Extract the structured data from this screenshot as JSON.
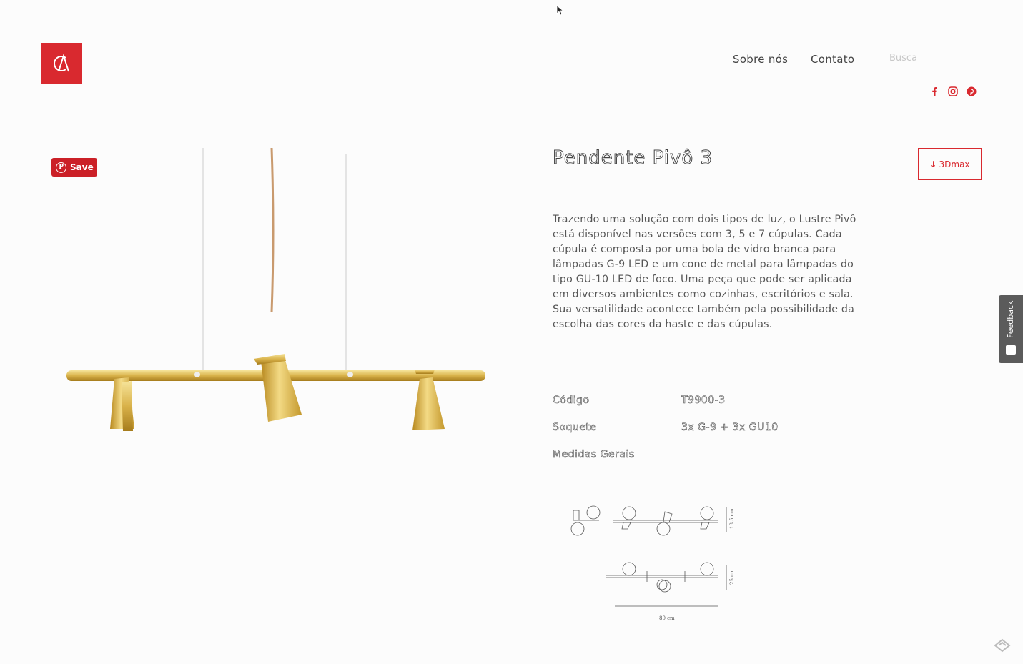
{
  "nav": {
    "about": "Sobre nós",
    "contact": "Contato"
  },
  "search": {
    "placeholder": "Busca"
  },
  "social": [
    "facebook-icon",
    "instagram-icon",
    "pinterest-icon"
  ],
  "pinterest_save": {
    "label": "Save"
  },
  "product": {
    "title": "Pendente Pivô 3",
    "download_label": "3Dmax",
    "description": "Trazendo uma solução com dois tipos de luz, o Lustre Pivô está disponível nas versões com 3, 5 e 7 cúpulas. Cada cúpula é composta por uma bola de vidro branca para lâmpadas G-9 LED e um cone de metal para lâmpadas do tipo GU-10 LED de foco. Uma peça que pode ser aplicada em diversos ambientes como cozinhas, escritórios e sala. Sua versatilidade acontece também pela possibilidade da escolha das cores da haste e das cúpulas.",
    "specs": [
      {
        "key": "Código",
        "value": "T9900-3"
      },
      {
        "key": "Soquete",
        "value": "3x G-9 + 3x GU10"
      },
      {
        "key": "Medidas Gerais",
        "value": ""
      }
    ],
    "dimensions": {
      "height_1": "18,5 cm",
      "height_2": "25 cm",
      "width": "80 cm"
    }
  },
  "feedback": {
    "label": "Feedback"
  },
  "colors": {
    "brand": "#d9292f",
    "gold": "#d9b24a"
  }
}
